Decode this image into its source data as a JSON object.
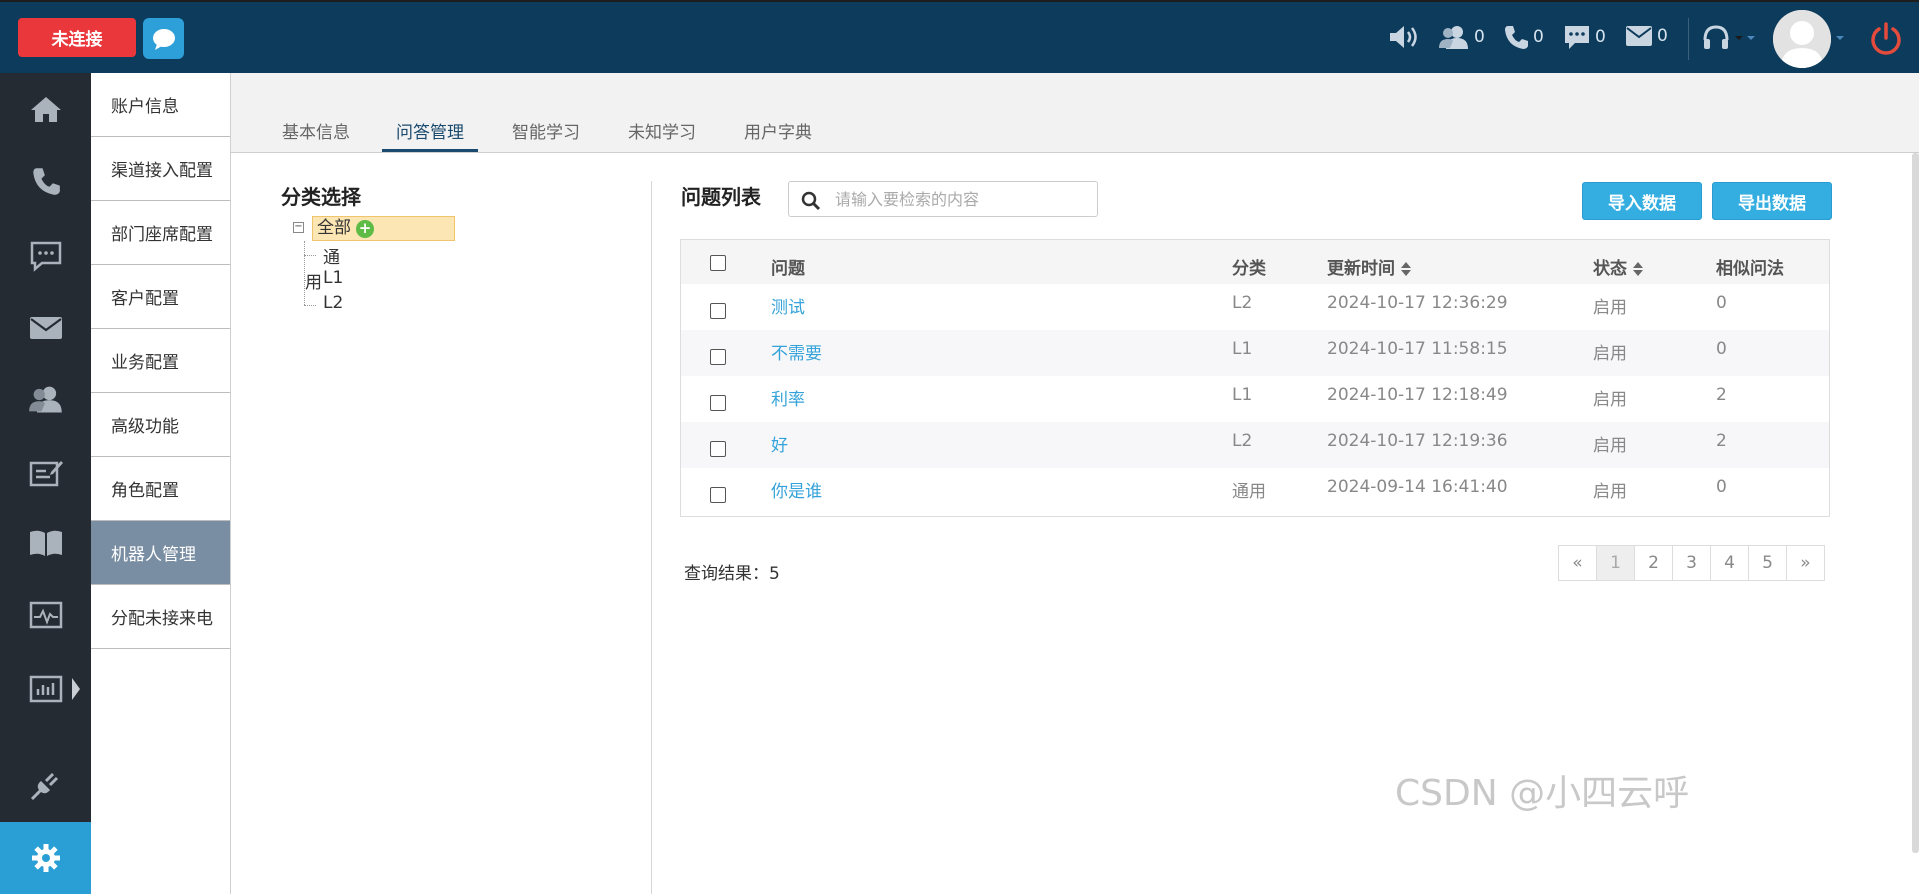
{
  "topbar": {
    "status_button": "未连接",
    "counts": {
      "agents": "0",
      "calls": "0",
      "chats": "0",
      "mails": "0"
    }
  },
  "icons": {
    "sidebar": [
      "home-icon",
      "phone-icon",
      "chat-bubble-icon",
      "mail-icon",
      "users-icon",
      "edit-report-icon",
      "book-icon",
      "pulse-monitor-icon",
      "bar-chart-icon",
      "plug-icon",
      "gear-icon"
    ]
  },
  "subnav": {
    "items": [
      "账户信息",
      "渠道接入配置",
      "部门座席配置",
      "客户配置",
      "业务配置",
      "高级功能",
      "角色配置",
      "机器人管理",
      "分配未接来电"
    ]
  },
  "tabs": [
    "基本信息",
    "问答管理",
    "智能学习",
    "未知学习",
    "用户字典"
  ],
  "category": {
    "title": "分类选择",
    "root": "全部",
    "children": [
      "通用",
      "L1",
      "L2"
    ]
  },
  "questions": {
    "title": "问题列表",
    "search_placeholder": "请输入要检索的内容",
    "import_button": "导入数据",
    "export_button": "导出数据",
    "headers": {
      "question": "问题",
      "category": "分类",
      "updated": "更新时间",
      "status": "状态",
      "similar": "相似问法"
    },
    "rows": [
      {
        "question": "测试",
        "category": "L2",
        "updated": "2024-10-17 12:36:29",
        "status": "启用",
        "similar": "0"
      },
      {
        "question": "不需要",
        "category": "L1",
        "updated": "2024-10-17 11:58:15",
        "status": "启用",
        "similar": "0"
      },
      {
        "question": "利率",
        "category": "L1",
        "updated": "2024-10-17 12:18:49",
        "status": "启用",
        "similar": "2"
      },
      {
        "question": "好",
        "category": "L2",
        "updated": "2024-10-17 12:19:36",
        "status": "启用",
        "similar": "2"
      },
      {
        "question": "你是谁",
        "category": "通用",
        "updated": "2024-09-14 16:41:40",
        "status": "启用",
        "similar": "0"
      }
    ],
    "result_label": "查询结果：",
    "result_count": "5"
  },
  "pagination": {
    "prev": "«",
    "pages": [
      "1",
      "2",
      "3",
      "4",
      "5"
    ],
    "next": "»",
    "current": "1"
  },
  "watermark": "CSDN @小四云呼",
  "colors": {
    "topbar": "#0d3b5c",
    "accent": "#34aee0",
    "danger": "#e9373b",
    "sidebar": "#252b33",
    "subnav_active": "#7a8ea3"
  }
}
